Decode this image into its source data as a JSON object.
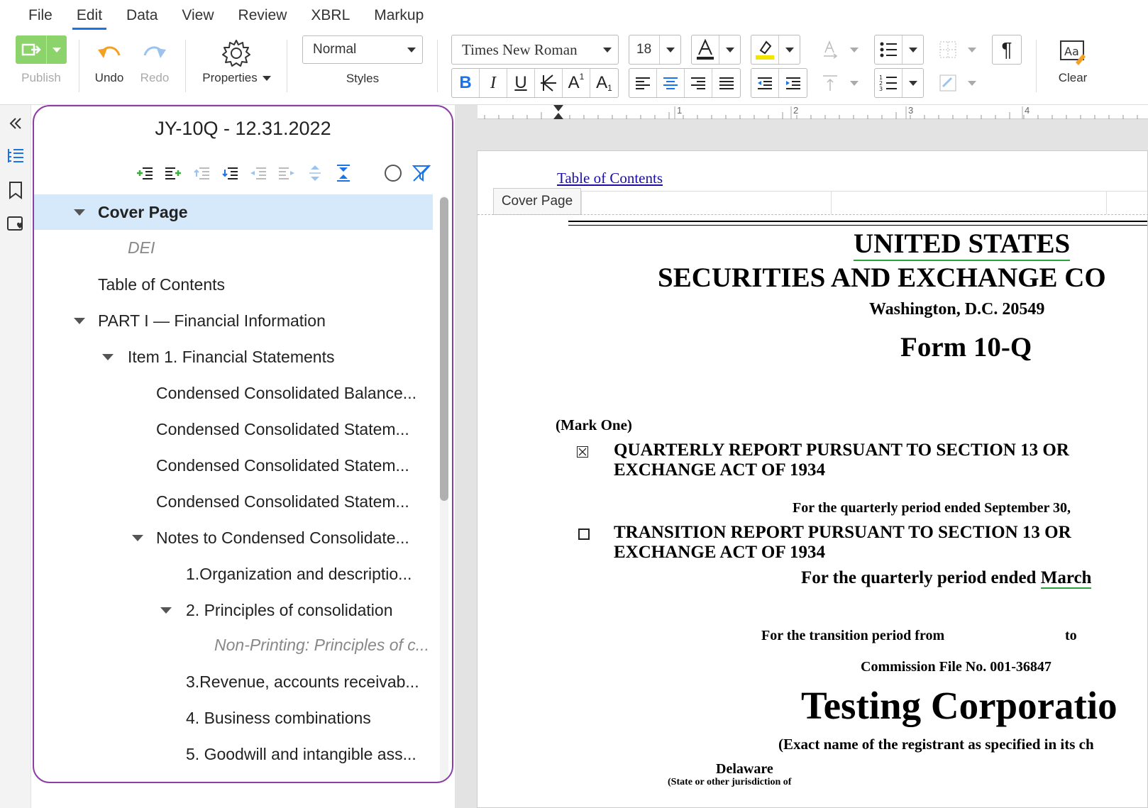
{
  "menu": [
    "File",
    "Edit",
    "Data",
    "View",
    "Review",
    "XBRL",
    "Markup"
  ],
  "menu_active": "Edit",
  "toolbar": {
    "publish_label": "Publish",
    "undo_label": "Undo",
    "redo_label": "Redo",
    "properties_label": "Properties",
    "style_value": "Normal",
    "styles_label": "Styles",
    "font_value": "Times New Roman",
    "size_value": "18",
    "clear_label": "Clear",
    "accent_green": "#8bd36a",
    "accent_blue": "#1a73e8"
  },
  "outline": {
    "title": "JY-10Q - 12.31.2022",
    "items": [
      "Cover Page",
      "DEI",
      "Table of Contents",
      "PART I — Financial Information",
      "Item 1. Financial Statements",
      "Condensed Consolidated Balance...",
      "Condensed Consolidated Statem...",
      "Condensed Consolidated Statem...",
      "Condensed Consolidated Statem...",
      "Notes to Condensed Consolidate...",
      "1.Organization and descriptio...",
      "2. Principles of consolidation",
      "Non-Printing: Principles of c...",
      "3.Revenue, accounts receivab...",
      "4. Business combinations",
      "5. Goodwill and intangible ass..."
    ]
  },
  "document": {
    "toc_link": "Table of Contents",
    "section_tab": "Cover Page",
    "ruler_marks": [
      "1",
      "2",
      "3",
      "4"
    ],
    "line1": "UNITED STATES",
    "line2": "SECURITIES AND EXCHANGE CO",
    "line3": "Washington, D.C. 20549",
    "form": "Form 10-Q",
    "mark_one": "(Mark One)",
    "quarterly_1": "QUARTERLY REPORT PURSUANT TO SECTION 13 OR",
    "quarterly_2": "EXCHANGE ACT OF 1934",
    "quarterly_period": "For the quarterly period ended September 30, ",
    "transition_1": "TRANSITION REPORT PURSUANT TO SECTION 13 OR",
    "transition_2": "EXCHANGE ACT OF 1934",
    "quarterly_period_2_prefix": "For the quarterly period ended ",
    "quarterly_period_2_word": "March",
    "transition_from": "For the transition period from",
    "transition_to": "to",
    "commission": "Commission File No. 001-36847",
    "company": "Testing Corporatio",
    "exact_name": "(Exact name of the registrant as specified in its ch",
    "state": "Delaware",
    "state_sub": "(State or other jurisdiction of"
  }
}
